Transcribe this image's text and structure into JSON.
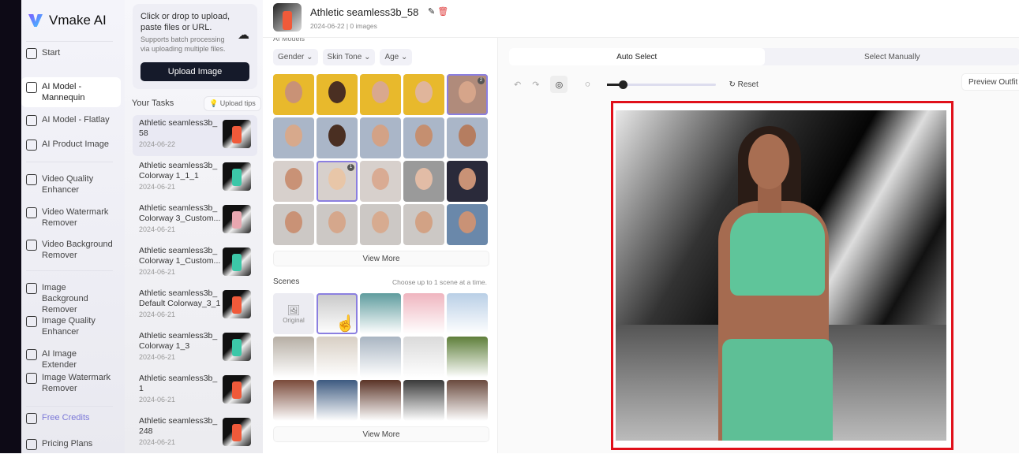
{
  "app": {
    "name": "Vmake AI"
  },
  "sidebar": {
    "items": [
      {
        "label": "Start",
        "icon": "sparkle-icon"
      },
      {
        "label": "AI Model - Mannequin",
        "icon": "mannequin-icon",
        "active": true
      },
      {
        "label": "AI Model - Flatlay",
        "icon": "shirt-icon"
      },
      {
        "label": "AI Product Image",
        "icon": "bag-icon"
      },
      {
        "label": "Video Quality Enhancer",
        "icon": "video-icon"
      },
      {
        "label": "Video Watermark Remover",
        "icon": "video-icon"
      },
      {
        "label": "Video Background Remover",
        "icon": "video-icon"
      },
      {
        "label": "Image Background Remover",
        "icon": "image-icon"
      },
      {
        "label": "Image Quality Enhancer",
        "icon": "image-icon"
      },
      {
        "label": "AI Image Extender",
        "icon": "expand-icon"
      },
      {
        "label": "Image Watermark Remover",
        "icon": "image-icon"
      },
      {
        "label": "Free Credits",
        "icon": "gift-icon"
      },
      {
        "label": "Pricing Plans",
        "icon": "pricing-icon"
      }
    ]
  },
  "upload": {
    "title": "Click or drop to upload, paste files or URL.",
    "subtitle": "Supports batch processing via uploading multiple files.",
    "button": "Upload Image"
  },
  "tasks": {
    "title": "Your Tasks",
    "tips": "Upload tips",
    "items": [
      {
        "name": "Athletic seamless3b_ 58",
        "date": "2024-06-22",
        "color": "#f05a3a"
      },
      {
        "name": "Athletic seamless3b_ Colorway 1_1_1",
        "date": "2024-06-21",
        "color": "#3cc7a8"
      },
      {
        "name": "Athletic seamless3b_ Colorway 3_Custom...",
        "date": "2024-06-21",
        "color": "#e8a7b0"
      },
      {
        "name": "Athletic seamless3b_ Colorway 1_Custom...",
        "date": "2024-06-21",
        "color": "#3cc7a8"
      },
      {
        "name": "Athletic seamless3b_ Default Colorway_3_1",
        "date": "2024-06-21",
        "color": "#f05a3a"
      },
      {
        "name": "Athletic seamless3b_ Colorway 1_3",
        "date": "2024-06-21",
        "color": "#3cc7a8"
      },
      {
        "name": "Athletic seamless3b_ 1",
        "date": "2024-06-21",
        "color": "#f05a3a"
      },
      {
        "name": "Athletic seamless3b_ 248",
        "date": "2024-06-21",
        "color": "#f05a3a"
      }
    ]
  },
  "header": {
    "title": "Athletic seamless3b_58",
    "subtitle": "2024-06-22 | 0 images"
  },
  "models": {
    "label": "AI Models",
    "filters": [
      "Gender",
      "Skin Tone",
      "Age"
    ],
    "view_more": "View More",
    "tiles": [
      {
        "bg": "#e8b92c",
        "skin": "#c99276"
      },
      {
        "bg": "#e8b92c",
        "skin": "#4a2f22"
      },
      {
        "bg": "#e8b92c",
        "skin": "#d9a88e"
      },
      {
        "bg": "#e8b92c",
        "skin": "#e0b59b"
      },
      {
        "bg": "#b08b7b",
        "skin": "#d6a58a",
        "badge": "2"
      },
      {
        "bg": "#aab6c8",
        "skin": "#d7a98c"
      },
      {
        "bg": "#aab6c8",
        "skin": "#4a2f22"
      },
      {
        "bg": "#aab6c8",
        "skin": "#d3a286"
      },
      {
        "bg": "#aab6c8",
        "skin": "#c58f70"
      },
      {
        "bg": "#aab6c8",
        "skin": "#b57d60"
      },
      {
        "bg": "#d7d0cc",
        "skin": "#c99276"
      },
      {
        "bg": "#d7d0cc",
        "skin": "#e8c6a8",
        "badge": "1"
      },
      {
        "bg": "#d7d0cc",
        "skin": "#d9ab93"
      },
      {
        "bg": "#9a9a9a",
        "skin": "#e2bca6"
      },
      {
        "bg": "#2a2a3a",
        "skin": "#c99276"
      },
      {
        "bg": "#ccc8c5",
        "skin": "#c99276"
      },
      {
        "bg": "#ccc8c5",
        "skin": "#d5a78c"
      },
      {
        "bg": "#ccc8c5",
        "skin": "#d7ab90"
      },
      {
        "bg": "#ccc8c5",
        "skin": "#d2a285"
      },
      {
        "bg": "#6a88aa",
        "skin": "#c99276"
      }
    ]
  },
  "scenes": {
    "label": "Scenes",
    "hint": "Choose up to 1 scene at a time.",
    "original": "Original",
    "view_more": "View More",
    "tiles": [
      "#ececf2",
      "#c8c8c8",
      "#5f9c9e",
      "#efb5bf",
      "#b9cfe6",
      "#b6aea4",
      "#d8cfc4",
      "#a9b5c2",
      "#dadada",
      "#5e7f3a",
      "#7a4a3a",
      "#3d5a80",
      "#5a3326",
      "#3a3a3a",
      "#6a4a3e"
    ]
  },
  "editor": {
    "tabs": [
      "Auto Select",
      "Select Manually"
    ],
    "reset": "Reset",
    "preview": "Preview Outfit",
    "brush_size": 0.14,
    "accent": "#e0101a"
  }
}
